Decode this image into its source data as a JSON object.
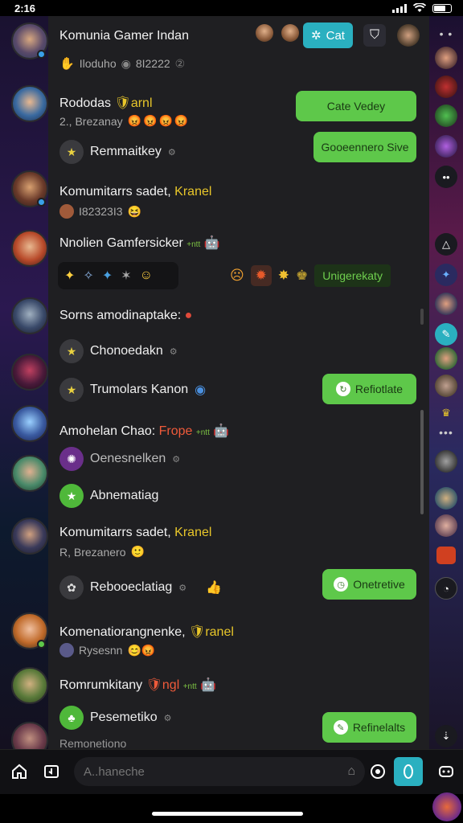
{
  "status_bar": {
    "time": "2:16"
  },
  "header": {
    "title": "Komunia Gamer Indan",
    "subtitle_prefix": "Iloduho",
    "subtitle_value": "8I2222",
    "cat_button_label": "Cat"
  },
  "rows": [
    {
      "title": "Rododas",
      "title_tag": "arnl",
      "subtitle": "2., Brezanay"
    },
    {
      "item_label": "Remmaitkey"
    },
    {
      "title_prefix": "Komumitarrs sadet,",
      "title_tag": "Kranel",
      "subtitle": "I82323I3"
    },
    {
      "title": "Nnolien Gamfersicker",
      "extra": "+ntt"
    },
    {
      "title": "Sorns amodinaptake:"
    },
    {
      "item_label": "Chonoedakn"
    },
    {
      "item_label": "Trumolars Kanon"
    },
    {
      "title_prefix": "Amohelan Chao:",
      "title_tag": "Frope",
      "extra": "+ntt"
    },
    {
      "item_label": "Oenesnelken"
    },
    {
      "item_label": "Abnematiag"
    },
    {
      "title_prefix": "Komumitarrs sadet,",
      "title_tag": "Kranel",
      "subtitle": "R, Brezanero"
    },
    {
      "item_label": "Rebooeclatiag"
    },
    {
      "title_prefix": "Komenatiorangnenke,",
      "title_tag": "ranel",
      "subtitle": "Rysesnn"
    },
    {
      "title_prefix": "Romrumkitany",
      "title_tag": "ngl",
      "extra": "+ntt"
    },
    {
      "item_label": "Pesemetiko"
    },
    {
      "item_label": "Remonetiono"
    }
  ],
  "buttons": {
    "btn1": "Cate Vedey",
    "btn2": "Gooeennero Sive",
    "btn3": "Refiotlate",
    "btn4": "Onetretive",
    "btn5": "Refinelalts"
  },
  "label_tag": "Unigerekaty",
  "search": {
    "placeholder": "A..haneche"
  },
  "colors": {
    "accent": "#2ab0c0",
    "green": "#5ec84a",
    "panel": "#1f1f22"
  }
}
